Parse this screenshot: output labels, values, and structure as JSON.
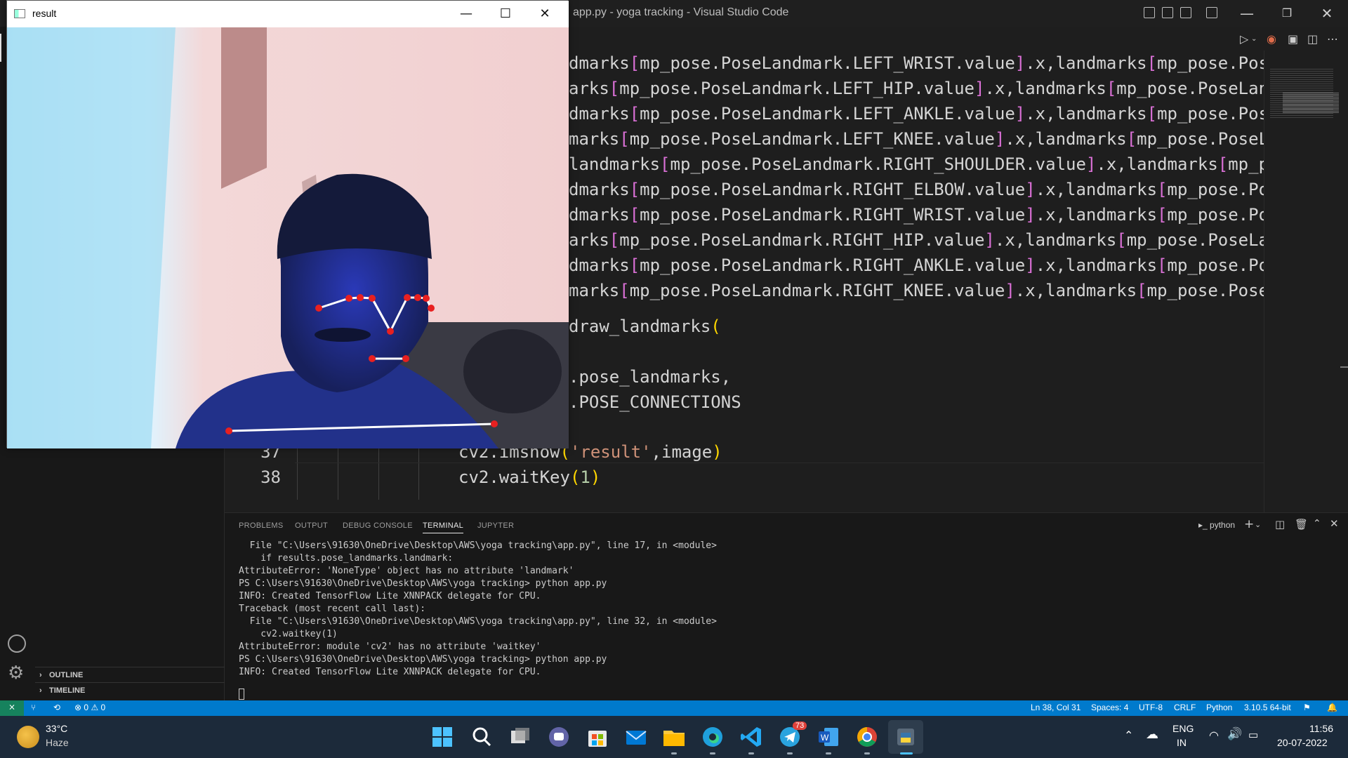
{
  "window": {
    "title": "app.py - yoga tracking - Visual Studio Code"
  },
  "result_window": {
    "title": "result",
    "minimize": "—",
    "maximize": "☐",
    "close": "✕"
  },
  "editor": {
    "lines": [
      {
        "pre": "dmarks",
        "mid": "mp_pose.PoseLandmark.LEFT_WRIST.value",
        "post": ".x,landmarks",
        "tail": "mp_pose.Pos"
      },
      {
        "pre": "arks",
        "mid": "mp_pose.PoseLandmark.LEFT_HIP.value",
        "post": ".x,landmarks",
        "tail": "mp_pose.PoseLan"
      },
      {
        "pre": "dmarks",
        "mid": "mp_pose.PoseLandmark.LEFT_ANKLE.value",
        "post": ".x,landmarks",
        "tail": "mp_pose.Pos"
      },
      {
        "pre": "marks",
        "mid": "mp_pose.PoseLandmark.LEFT_KNEE.value",
        "post": ".x,landmarks",
        "tail": "mp_pose.PoseL"
      },
      {
        "pre": "landmarks",
        "mid": "mp_pose.PoseLandmark.RIGHT_SHOULDER.value",
        "post": ".x,landmarks",
        "tail": "mp_p"
      },
      {
        "pre": "dmarks",
        "mid": "mp_pose.PoseLandmark.RIGHT_ELBOW.value",
        "post": ".x,landmarks",
        "tail": "mp_pose.Po"
      },
      {
        "pre": "dmarks",
        "mid": "mp_pose.PoseLandmark.RIGHT_WRIST.value",
        "post": ".x,landmarks",
        "tail": "mp_pose.Po"
      },
      {
        "pre": "arks",
        "mid": "mp_pose.PoseLandmark.RIGHT_HIP.value",
        "post": ".x,landmarks",
        "tail": "mp_pose.PoseLa"
      },
      {
        "pre": "dmarks",
        "mid": "mp_pose.PoseLandmark.RIGHT_ANKLE.value",
        "post": ".x,landmarks",
        "tail": "mp_pose.Po"
      },
      {
        "pre": "marks",
        "mid": "mp_pose.PoseLandmark.RIGHT_KNEE.value",
        "post": ".x,landmarks",
        "tail": "mp_pose.Pose"
      }
    ],
    "draw_line": "draw_landmarks",
    "pose_landmarks": ".pose_landmarks,",
    "pose_connections": ".POSE_CONNECTIONS",
    "line37_num": "37",
    "line37_fn": "cv2.imshow",
    "line37_str": "'result'",
    "line37_rest": ",image",
    "line38_num": "38",
    "line38_fn": "cv2.waitKey",
    "line38_arg": "1"
  },
  "sidebar": {
    "outline": "OUTLINE",
    "timeline": "TIMELINE"
  },
  "panel": {
    "tabs": [
      "PROBLEMS",
      "OUTPUT",
      "DEBUG CONSOLE",
      "TERMINAL",
      "JUPYTER"
    ],
    "active_tab": "TERMINAL",
    "shell": "python",
    "terminal_lines": [
      "  File \"C:\\Users\\91630\\OneDrive\\Desktop\\AWS\\yoga tracking\\app.py\", line 17, in <module>",
      "    if results.pose_landmarks.landmark:",
      "AttributeError: 'NoneType' object has no attribute 'landmark'",
      "PS C:\\Users\\91630\\OneDrive\\Desktop\\AWS\\yoga tracking> python app.py",
      "INFO: Created TensorFlow Lite XNNPACK delegate for CPU.",
      "Traceback (most recent call last):",
      "  File \"C:\\Users\\91630\\OneDrive\\Desktop\\AWS\\yoga tracking\\app.py\", line 32, in <module>",
      "    cv2.waitkey(1)",
      "AttributeError: module 'cv2' has no attribute 'waitkey'",
      "PS C:\\Users\\91630\\OneDrive\\Desktop\\AWS\\yoga tracking> python app.py",
      "INFO: Created TensorFlow Lite XNNPACK delegate for CPU."
    ]
  },
  "statusbar": {
    "errors": "0",
    "warnings": "0",
    "position": "Ln 38, Col 31",
    "spaces": "Spaces: 4",
    "encoding": "UTF-8",
    "eol": "CRLF",
    "language": "Python",
    "interpreter": "3.10.5 64-bit"
  },
  "taskbar": {
    "temp": "33°C",
    "weather": "Haze",
    "lang1": "ENG",
    "lang2": "IN",
    "time": "11:56",
    "date": "20-07-2022",
    "telegram_badge": "73"
  },
  "colors": {
    "accent": "#007acc",
    "bracket": "#da70d6",
    "string": "#ce9178",
    "number": "#b5cea8"
  },
  "icons": [
    "restore-icon",
    "split-editor-icon",
    "run-icon",
    "copilot-icon",
    "more-icon",
    "account-icon",
    "settings-gear-icon",
    "remote-icon",
    "branch-icon",
    "sync-icon",
    "error-icon",
    "warning-icon",
    "bell-icon",
    "weather-icon",
    "windows-start-icon",
    "search-icon",
    "task-view-icon",
    "teams-chat-icon",
    "store-icon",
    "mail-icon",
    "file-explorer-icon",
    "edge-icon",
    "vscode-icon",
    "telegram-icon",
    "word-icon",
    "chrome-icon",
    "python-icon",
    "wifi-icon",
    "volume-icon",
    "battery-icon"
  ]
}
